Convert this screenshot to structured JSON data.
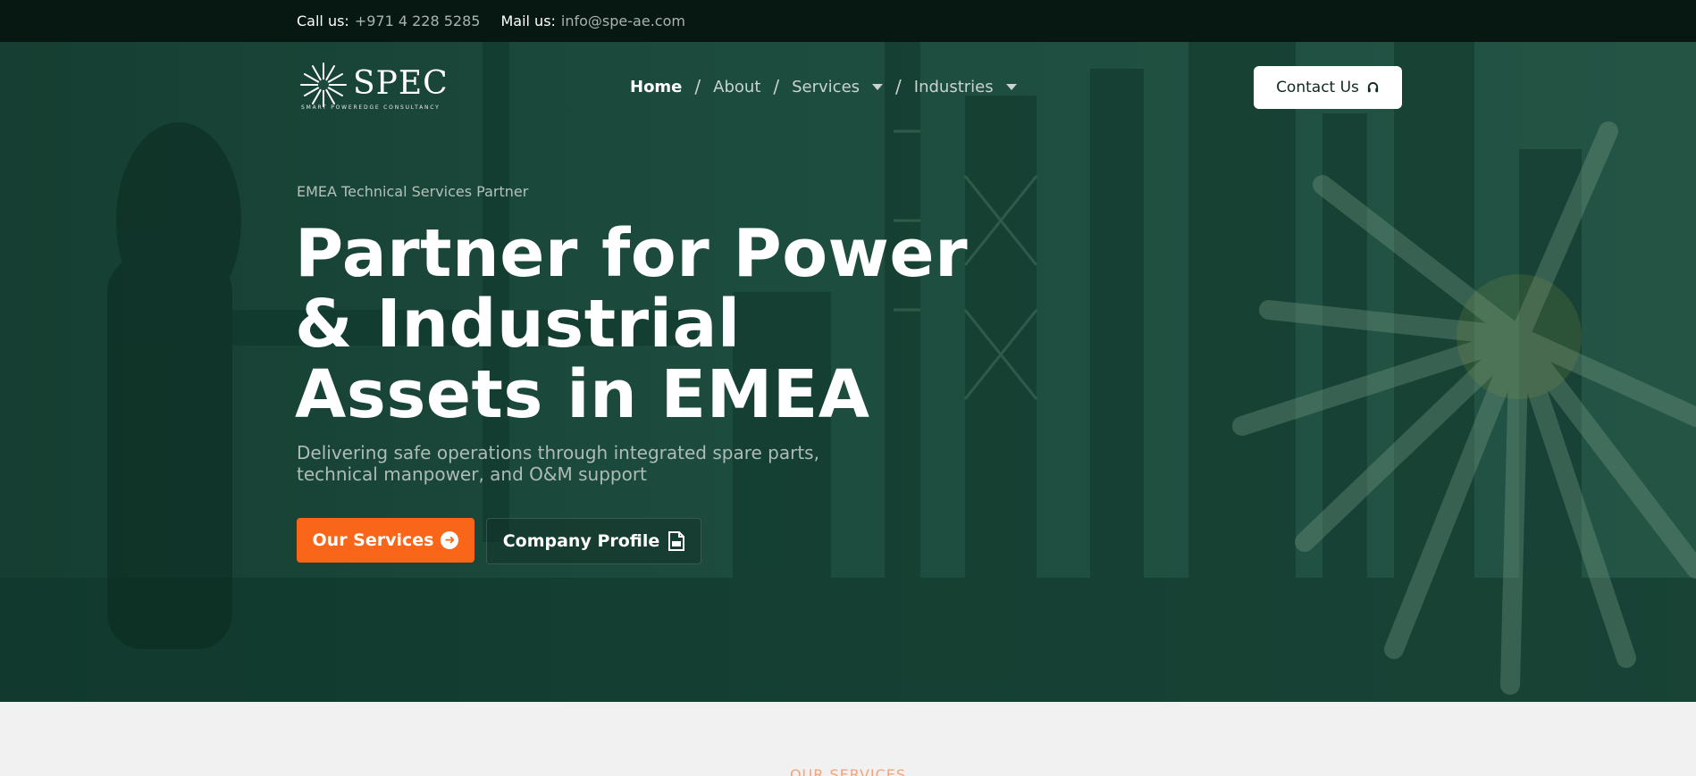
{
  "topbar": {
    "call_label": "Call us:",
    "call_value": "+971 4 228 5285",
    "mail_label": "Mail us:",
    "mail_value": "info@spe-ae.com"
  },
  "header": {
    "logo_text": "SPEC",
    "logo_tagline": "SMART POWEREDGE CONSULTANCY",
    "nav": [
      {
        "label": "Home",
        "active": true,
        "dropdown": false
      },
      {
        "label": "About",
        "active": false,
        "dropdown": false
      },
      {
        "label": "Services",
        "active": false,
        "dropdown": true
      },
      {
        "label": "Industries",
        "active": false,
        "dropdown": true
      }
    ],
    "nav_separator": "/",
    "contact_label": "Contact Us",
    "contact_icon": "headset-icon"
  },
  "hero": {
    "eyebrow": "EMEA Technical Services Partner",
    "headline_line1": "Partner for Power",
    "headline_line2": "& Industrial",
    "headline_line3": "Assets in EMEA",
    "subtitle": "Delivering safe operations through integrated spare parts, technical manpower, and O&M support",
    "primary_button": "Our Services",
    "primary_icon": "arrow-right-circle-icon",
    "secondary_button": "Company Profile",
    "secondary_icon": "pdf-icon"
  },
  "services": {
    "eyebrow": "OUR SERVICES"
  },
  "colors": {
    "topbar_bg": "#071812",
    "hero_tint": "#1a4a3c",
    "accent_orange": "#fa6619",
    "white": "#ffffff"
  }
}
